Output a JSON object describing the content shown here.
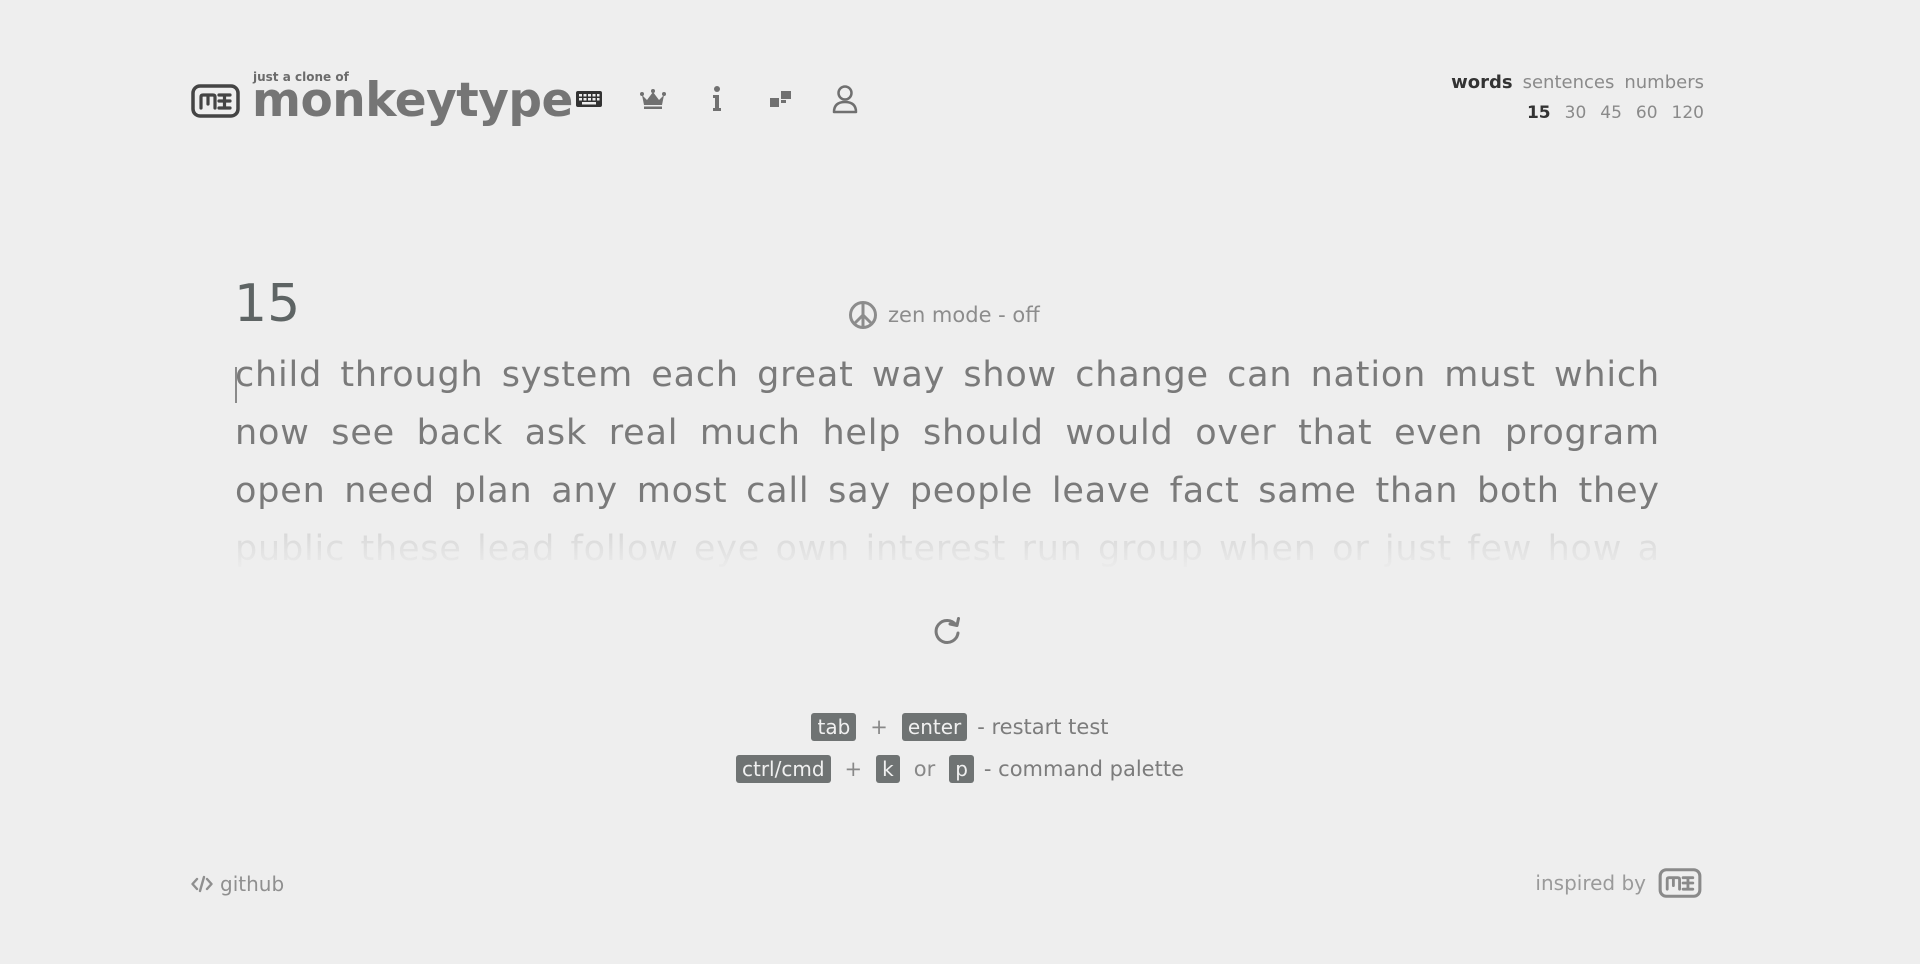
{
  "header": {
    "logo_subtitle": "just a clone of",
    "logo_title": "monkeytype",
    "nav": [
      {
        "name": "typing-test",
        "icon": "keyboard-icon"
      },
      {
        "name": "leaderboard",
        "icon": "crown-icon"
      },
      {
        "name": "about",
        "icon": "info-icon"
      },
      {
        "name": "settings",
        "icon": "blocks-icon"
      },
      {
        "name": "account",
        "icon": "user-icon"
      }
    ]
  },
  "modes": {
    "types": [
      "words",
      "sentences",
      "numbers"
    ],
    "active_type": "words",
    "counts": [
      "15",
      "30",
      "45",
      "60",
      "120"
    ],
    "active_count": "15"
  },
  "test": {
    "counter": "15",
    "zen_mode_label": "zen mode - off",
    "lines": [
      [
        "child",
        "through",
        "system",
        "each",
        "great",
        "way",
        "show",
        "change",
        "can",
        "nation",
        "must",
        "which"
      ],
      [
        "now",
        "see",
        "back",
        "ask",
        "real",
        "much",
        "help",
        "should",
        "would",
        "over",
        "that",
        "even",
        "program"
      ],
      [
        "open",
        "need",
        "plan",
        "any",
        "most",
        "call",
        "say",
        "people",
        "leave",
        "fact",
        "same",
        "than",
        "both",
        "they"
      ],
      [
        "public",
        "these",
        "lead",
        "follow",
        "eye",
        "own",
        "interest",
        "run",
        "group",
        "when",
        "or",
        "just",
        "few",
        "how",
        "a"
      ]
    ]
  },
  "hints": {
    "restart": {
      "key1": "tab",
      "plus": "+",
      "key2": "enter",
      "label": "- restart test"
    },
    "palette": {
      "key1": "ctrl/cmd",
      "plus": "+",
      "key2": "k",
      "or": "or",
      "key3": "p",
      "label": "- command palette"
    }
  },
  "footer": {
    "github_label": "github",
    "inspired_label": "inspired by"
  },
  "colors": {
    "background": "#eeeeee",
    "text_dim": "#7a7a7a",
    "text_active": "#333333",
    "key_bg": "#6f7373"
  }
}
